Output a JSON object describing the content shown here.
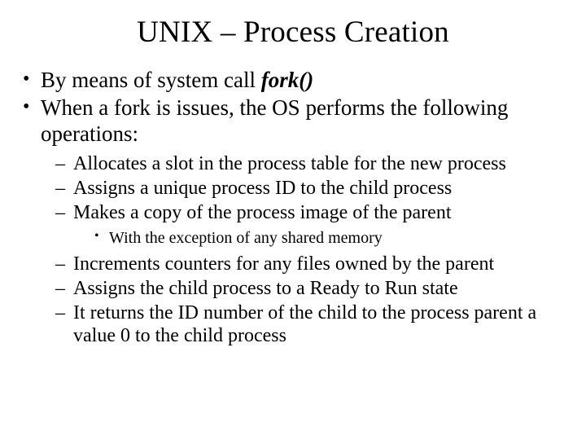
{
  "title": "UNIX – Process Creation",
  "bullets": {
    "b1_pre": "By means of system call ",
    "b1_fork": "fork()",
    "b2": "When a fork is issues, the OS performs the following operations:",
    "sub": {
      "s1": "Allocates a slot in the process table for the new process",
      "s2": "Assigns a unique process ID to the child process",
      "s3": "Makes a copy of the process image of the parent",
      "s3a": "With the exception of any shared memory",
      "s4": "Increments counters for any files owned by the parent",
      "s5": "Assigns the child process to a Ready to Run state",
      "s6": "It returns the ID number of the child to the process parent a value 0 to the child process"
    }
  }
}
